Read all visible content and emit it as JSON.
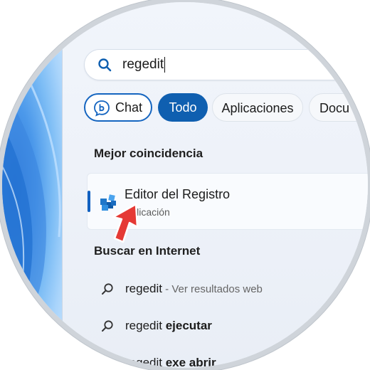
{
  "search": {
    "query": "regedit"
  },
  "filters": {
    "chat": "Chat",
    "todo": "Todo",
    "apps": "Aplicaciones",
    "docs": "Docu"
  },
  "best_match": {
    "heading": "Mejor coincidencia",
    "title": "Editor del Registro",
    "subtitle": "Aplicación"
  },
  "internet": {
    "heading": "Buscar en Internet",
    "results": [
      {
        "query": "regedit",
        "hint": " - Ver resultados web"
      },
      {
        "query": "regedit",
        "bold": " ejecutar"
      },
      {
        "query": "regedit",
        "bold": " exe abrir"
      }
    ]
  },
  "colors": {
    "accent": "#0f5fb0",
    "arrow": "#e53935"
  },
  "icons": {
    "search": "search-icon",
    "chat": "copilot-chat-icon",
    "regedit": "registry-editor-icon",
    "pointer": "red-arrow-pointer"
  }
}
